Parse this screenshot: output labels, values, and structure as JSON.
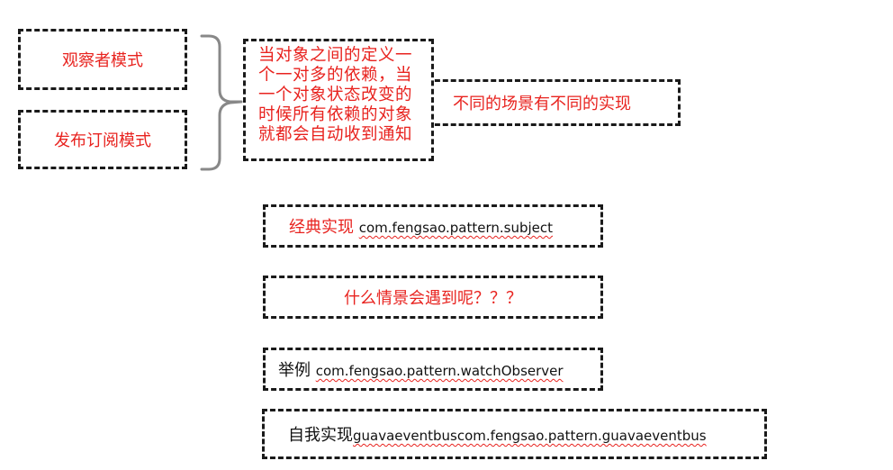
{
  "left_boxes": {
    "observer": "观察者模式",
    "pubsub": "发布订阅模式"
  },
  "definition": {
    "lines": [
      "当对象之间的定义一",
      "个一对多的依赖，当",
      "一个对象状态改变的",
      "时候所有依赖的对象",
      "就都会自动收到通知"
    ]
  },
  "difference_note": "不同的场景有不同的实现",
  "classic": {
    "label": "经典实现",
    "package": "com.fengsao.pattern.subject"
  },
  "scenario_question": "什么情景会遇到呢？？？",
  "example": {
    "label": "举例",
    "package": "com.fengsao.pattern.watchObserver"
  },
  "self_impl": {
    "label": "自我实现",
    "package": "guavaeventbuscom.fengsao.pattern.guavaeventbus"
  },
  "colors": {
    "accent_red": "#e8231f",
    "border": "#1a1a1a",
    "brace": "#888888"
  }
}
